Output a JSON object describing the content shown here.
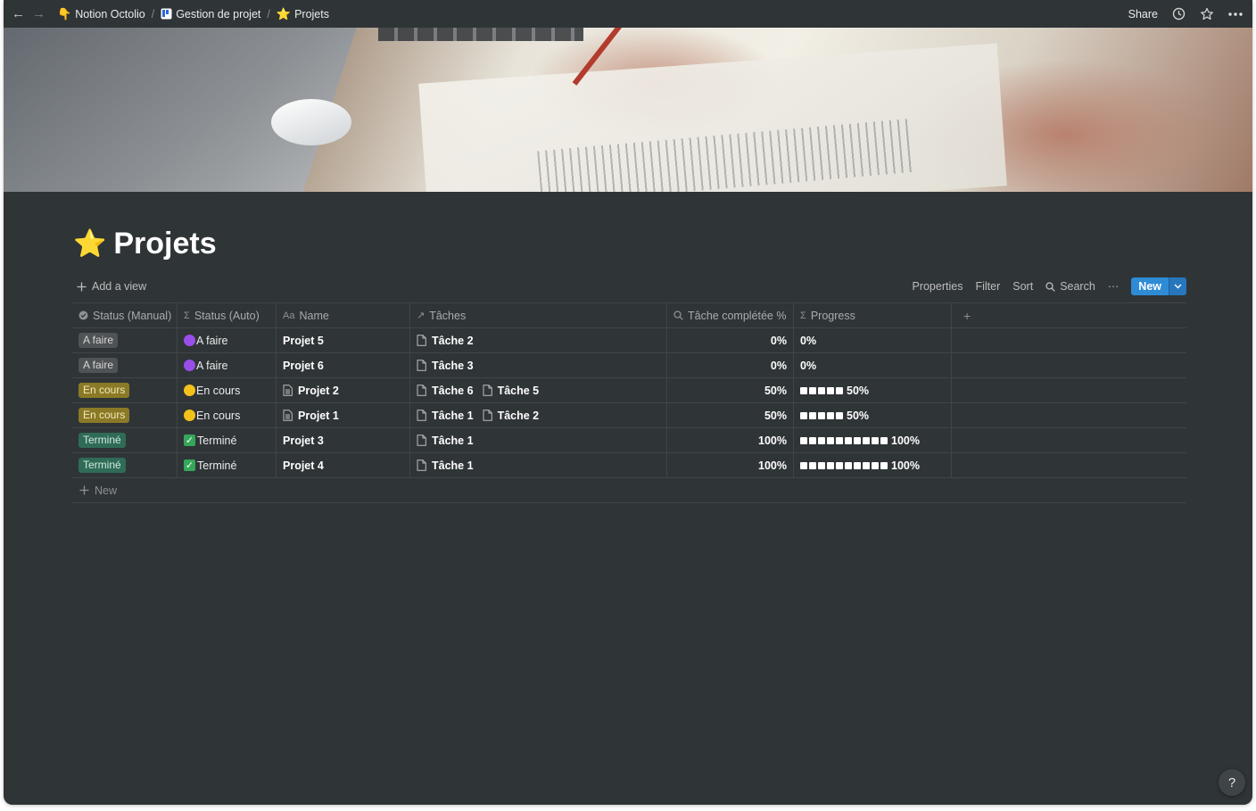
{
  "breadcrumbs": [
    {
      "icon": "👇",
      "label": "Notion Octolio"
    },
    {
      "icon": "board",
      "label": "Gestion de projet"
    },
    {
      "icon": "⭐",
      "label": "Projets"
    }
  ],
  "topbar": {
    "share_label": "Share",
    "separator": "/"
  },
  "page": {
    "icon": "⭐",
    "title": "Projets"
  },
  "viewbar": {
    "add_view_label": "Add a view",
    "properties_label": "Properties",
    "filter_label": "Filter",
    "sort_label": "Sort",
    "search_label": "Search",
    "more_label": "···",
    "new_label": "New"
  },
  "table": {
    "columns": [
      {
        "label": "Status (Manual)",
        "icon": "status-icon"
      },
      {
        "label": "Status (Auto)",
        "icon": "sigma-icon"
      },
      {
        "label": "Name",
        "icon": "text-icon"
      },
      {
        "label": "Tâches",
        "icon": "relation-arrow-icon"
      },
      {
        "label": "Tâche complétée %",
        "icon": "search-icon"
      },
      {
        "label": "Progress",
        "icon": "sigma-icon"
      }
    ],
    "rows": [
      {
        "status_manual": "A faire",
        "status_auto": "A faire",
        "name": "Projet 5",
        "tasks": [
          "Tâche 2"
        ],
        "pct": "0%",
        "progress": "0%"
      },
      {
        "status_manual": "A faire",
        "status_auto": "A faire",
        "name": "Projet 6",
        "tasks": [
          "Tâche 3"
        ],
        "pct": "0%",
        "progress": "0%"
      },
      {
        "status_manual": "En cours",
        "status_auto": "En cours",
        "name": "Projet 2",
        "tasks": [
          "Tâche 6",
          "Tâche 5"
        ],
        "pct": "50%",
        "progress": "50%"
      },
      {
        "status_manual": "En cours",
        "status_auto": "En cours",
        "name": "Projet 1",
        "tasks": [
          "Tâche 1",
          "Tâche 2"
        ],
        "pct": "50%",
        "progress": "50%"
      },
      {
        "status_manual": "Terminé",
        "status_auto": "Terminé",
        "name": "Projet 3",
        "tasks": [
          "Tâche 1"
        ],
        "pct": "100%",
        "progress": "100%"
      },
      {
        "status_manual": "Terminé",
        "status_auto": "Terminé",
        "name": "Projet 4",
        "tasks": [
          "Tâche 1"
        ],
        "pct": "100%",
        "progress": "100%"
      }
    ],
    "new_row_label": "New"
  },
  "help_label": "?",
  "colors": {
    "background": "#2f3437",
    "accent": "#2e8bd6",
    "tag_gray": "#4f5356",
    "tag_yellow": "#8a7a27",
    "tag_green": "#2f6b57"
  }
}
